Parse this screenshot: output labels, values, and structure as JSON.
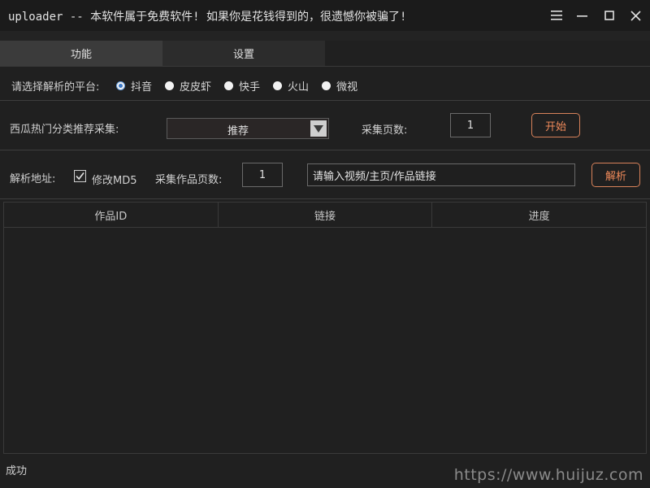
{
  "window": {
    "title": "uploader -- 本软件属于免费软件! 如果你是花钱得到的，很遗憾你被骗了!"
  },
  "tabs": [
    {
      "label": "功能",
      "active": true
    },
    {
      "label": "设置",
      "active": false
    }
  ],
  "platform": {
    "label": "请选择解析的平台:",
    "options": [
      "抖音",
      "皮皮虾",
      "快手",
      "火山",
      "微视"
    ],
    "selected": "抖音"
  },
  "xigua": {
    "label": "西瓜热门分类推荐采集:",
    "category_value": "推荐",
    "pages_label": "采集页数:",
    "pages_value": "1",
    "start_button": "开始"
  },
  "parse": {
    "label": "解析地址:",
    "md5_label": "修改MD5",
    "md5_checked": true,
    "pages_label": "采集作品页数:",
    "pages_value": "1",
    "url_value": "请输入视频/主页/作品链接",
    "parse_button": "解析"
  },
  "table": {
    "columns": [
      "作品ID",
      "链接",
      "进度"
    ],
    "rows": []
  },
  "status": {
    "text": "成功"
  },
  "watermark": "https://www.huijuz.com",
  "colors": {
    "accent_orange": "#f08a5a",
    "radio_checked": "#3a78c8",
    "background": "#202020"
  }
}
